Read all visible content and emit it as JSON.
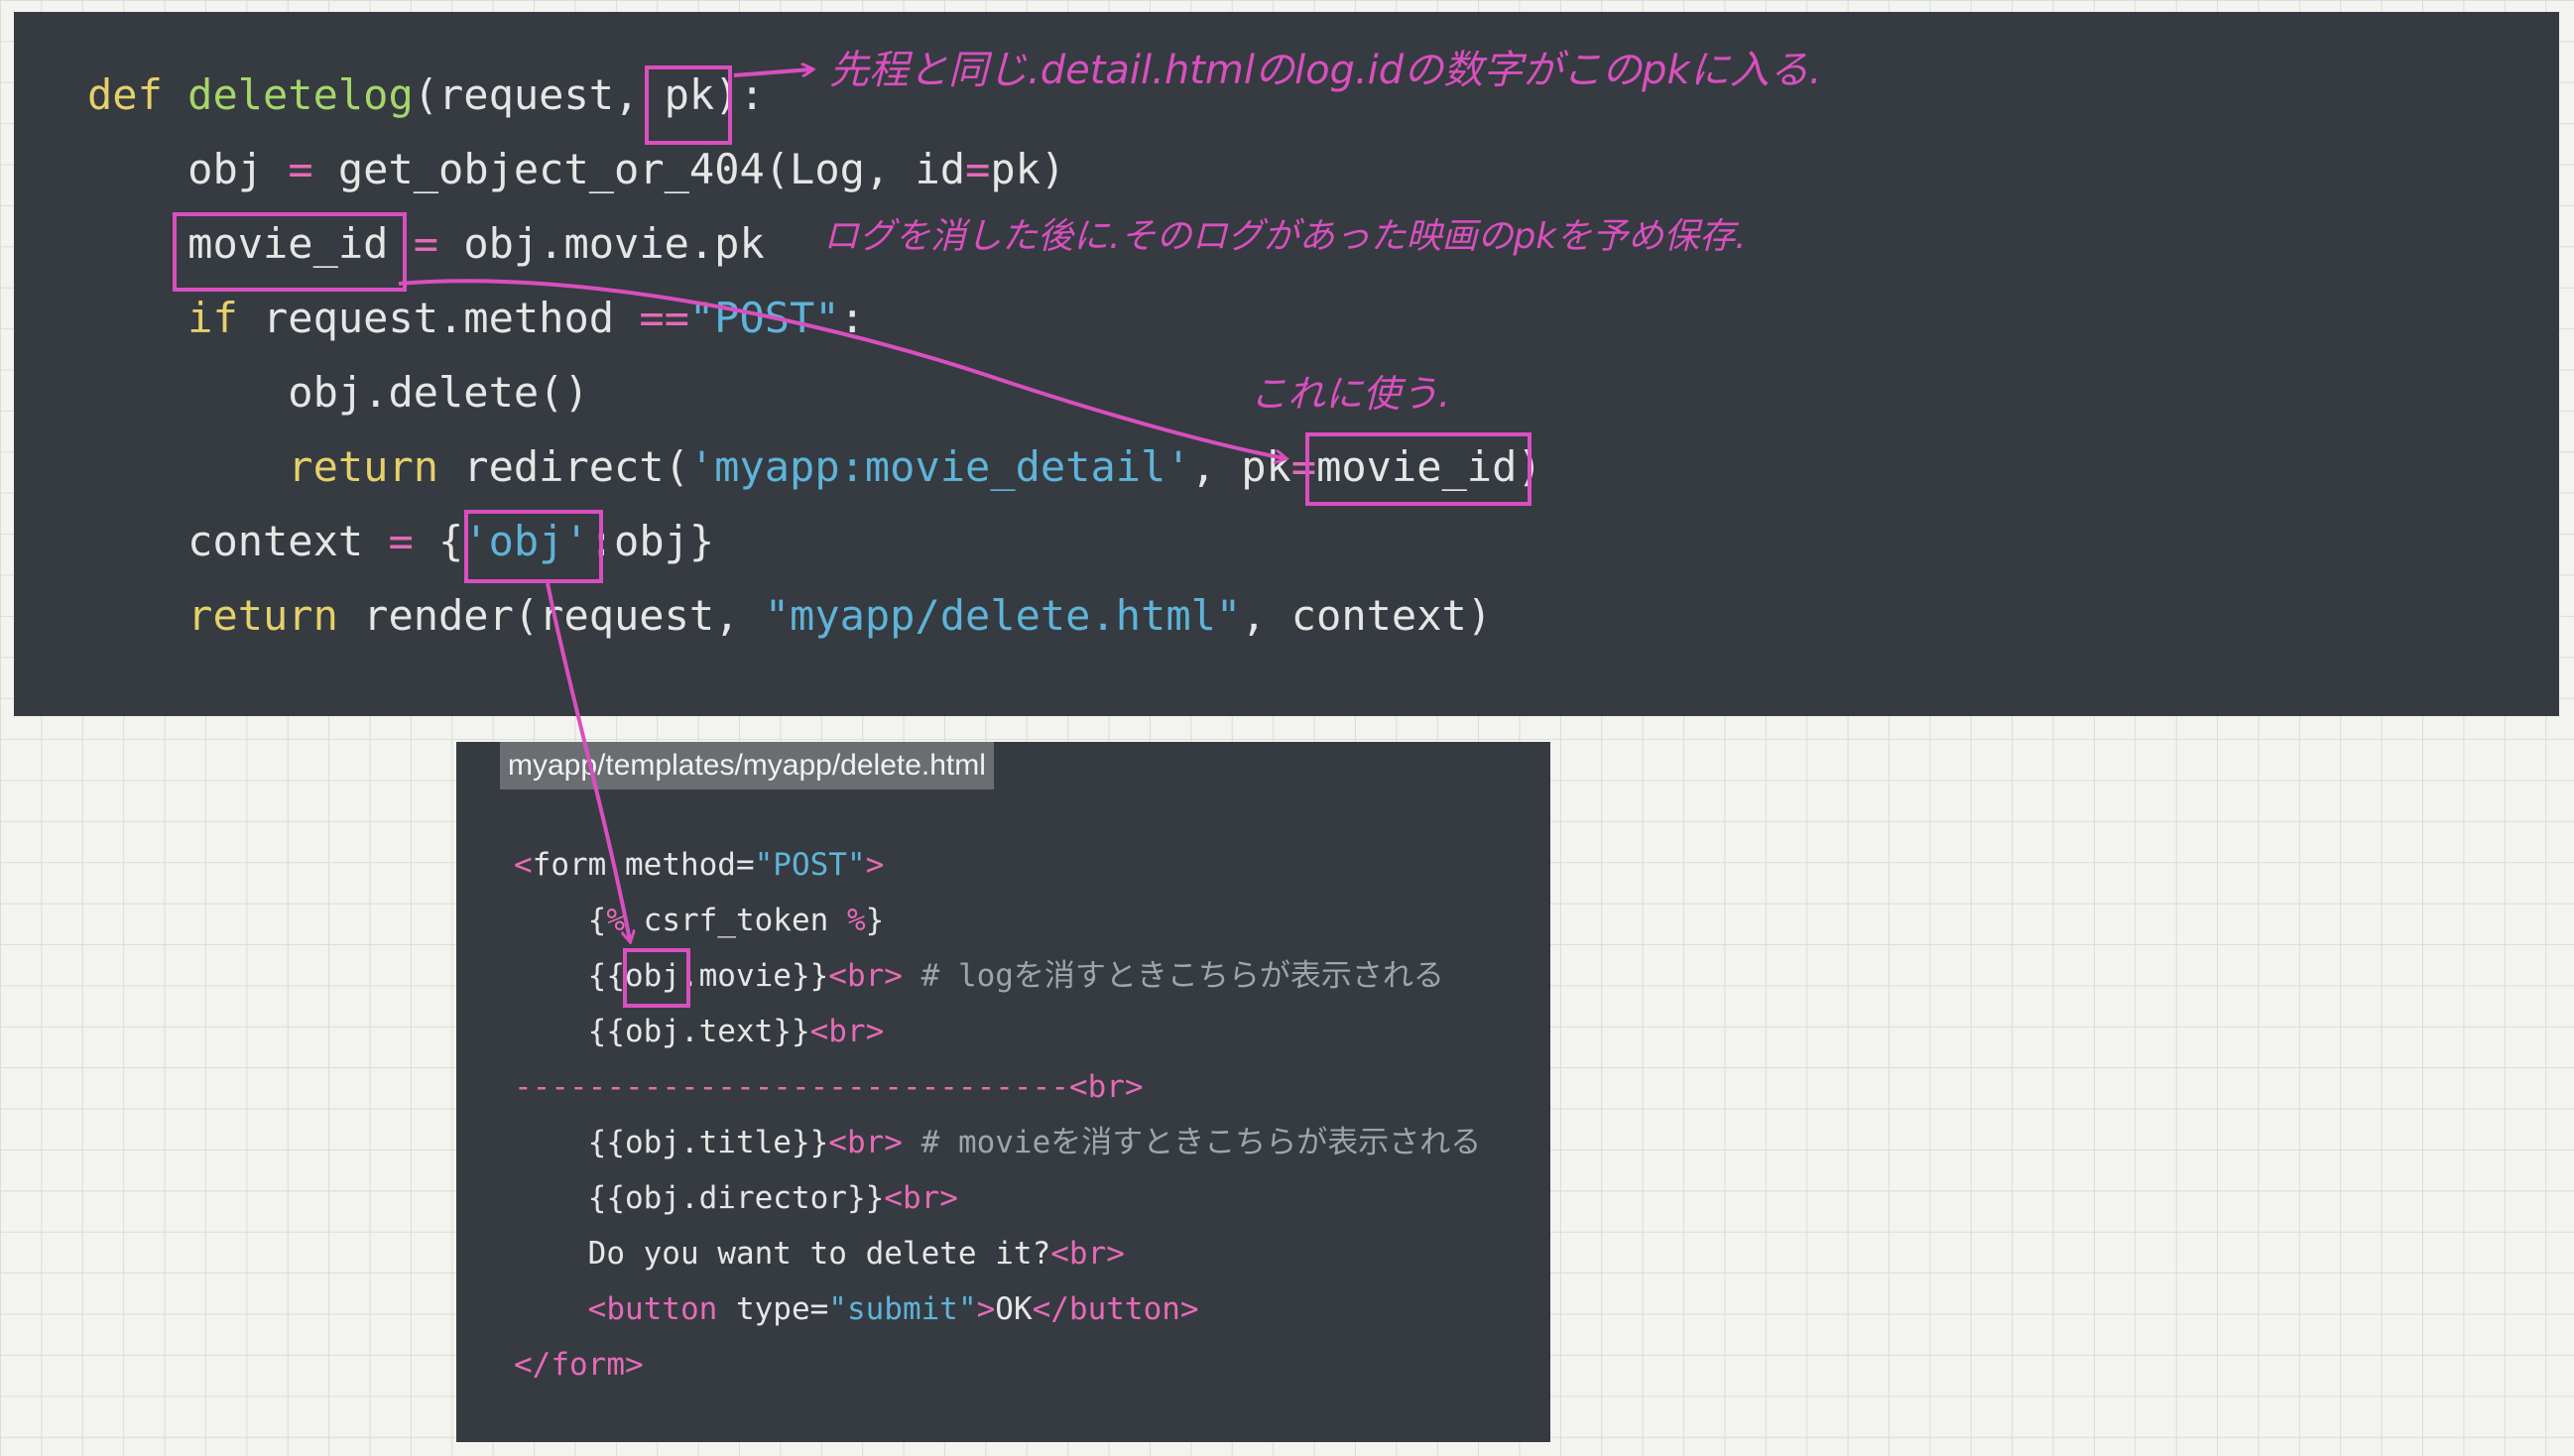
{
  "top_code": {
    "line1": {
      "def": "def",
      "name": "deletelog",
      "args": "(request, pk):"
    },
    "line2": {
      "indent": "    ",
      "a": "obj ",
      "eq": "=",
      "b": " get_object_or_404(Log, id",
      "eq2": "=",
      "c": "pk)"
    },
    "line3": {
      "indent": "    ",
      "a": "movie_id ",
      "eq": "=",
      "b": " obj.movie.pk"
    },
    "line4": {
      "indent": "    ",
      "if": "if",
      "a": " request.method ",
      "eq": "==",
      "str": "\"POST\"",
      "b": ":"
    },
    "line5": {
      "indent": "        ",
      "a": "obj.delete()"
    },
    "line6": {
      "indent": "        ",
      "ret": "return",
      "a": " redirect(",
      "str": "'myapp:movie_detail'",
      "b": ", pk",
      "eq": "=",
      "c": "movie_id)"
    },
    "line7": {
      "indent": "    ",
      "a": "context ",
      "eq": "=",
      "b": " {",
      "str": "'obj'",
      "c": ":obj}"
    },
    "line8": {
      "indent": "    ",
      "ret": "return",
      "a": " render(request, ",
      "str": "\"myapp/delete.html\"",
      "b": ", context)"
    }
  },
  "bottom_code": {
    "file_label": "myapp/templates/myapp/delete.html",
    "line1": {
      "lt": "<",
      "tag": "form",
      "a": " method=",
      "str": "\"POST\"",
      "gt": ">"
    },
    "line2": {
      "indent": "    ",
      "a": "{",
      "pct": "%",
      "b": " csrf_token ",
      "pct2": "%",
      "c": "}"
    },
    "line3": {
      "indent": "    ",
      "a": "{{obj.movie}}",
      "br": "<br>",
      "cm": " # logを消すときこちらが表示される"
    },
    "line4": {
      "indent": "    ",
      "a": "{{obj.text}}",
      "br": "<br>"
    },
    "line5": {
      "dash": "------------------------------",
      "br": "<br>"
    },
    "line6": {
      "indent": "    ",
      "a": "{{obj.title}}",
      "br": "<br>",
      "cm": " # movieを消すときこちらが表示される"
    },
    "line7": {
      "indent": "    ",
      "a": "{{obj.director}}",
      "br": "<br>"
    },
    "line8": {
      "indent": "    ",
      "a": "Do you want to delete it?",
      "br": "<br>"
    },
    "line9": {
      "indent": "    ",
      "open": "<button",
      "a": " type=",
      "str": "\"submit\"",
      "gt": ">",
      "b": "OK",
      "close": "</button>"
    },
    "line10": {
      "close": "</form>"
    }
  },
  "annotations": {
    "pk_note": "先程と同じ.detail.htmlのlog.idの数字がこのpkに入る.",
    "movie_id_note": "ログを消した後に.そのログがあった映画のpkを予め保存.",
    "use_note": "これに使う."
  },
  "colors": {
    "background": "#f3f4ef",
    "panel": "#353b40",
    "annotation": "#d94fbf",
    "keyword": "#e6d06a",
    "function": "#a6d66a",
    "string": "#5fb3d9"
  }
}
